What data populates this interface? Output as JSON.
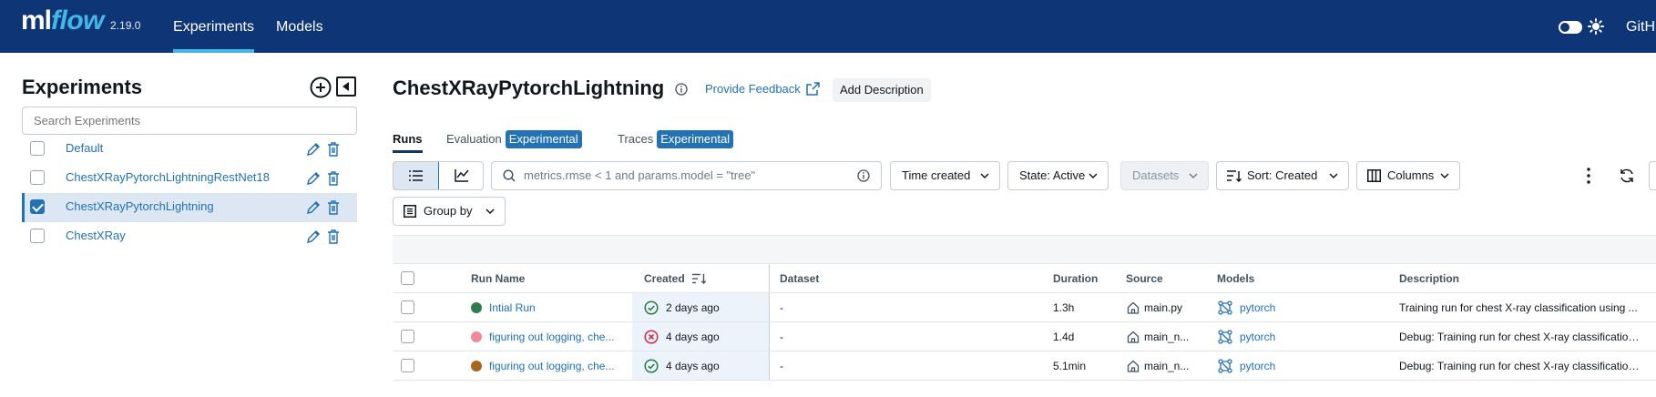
{
  "header": {
    "logo_ml": "ml",
    "logo_flow": "flow",
    "version": "2.19.0",
    "nav": [
      "Experiments",
      "Models"
    ],
    "github": "GitH",
    "brand_color": "#0e3576",
    "accent_color": "#43b7e8"
  },
  "sidebar": {
    "title": "Experiments",
    "search_placeholder": "Search Experiments",
    "items": [
      {
        "label": "Default",
        "checked": false
      },
      {
        "label": "ChestXRayPytorchLightningRestNet18",
        "checked": false
      },
      {
        "label": "ChestXRayPytorchLightning",
        "checked": true
      },
      {
        "label": "ChestXRay",
        "checked": false
      }
    ]
  },
  "main": {
    "title": "ChestXRayPytorchLightning",
    "feedback": "Provide Feedback",
    "add_description": "Add Description",
    "tabs": {
      "runs": "Runs",
      "evaluation": "Evaluation",
      "traces": "Traces",
      "badge": "Experimental"
    },
    "toolbar": {
      "filter_placeholder": "metrics.rmse < 1 and params.model = \"tree\"",
      "time_created": "Time created",
      "state": "State: Active",
      "datasets": "Datasets",
      "sort": "Sort: Created",
      "columns": "Columns",
      "group_by": "Group by"
    }
  },
  "table": {
    "columns": {
      "run_name": "Run Name",
      "created": "Created",
      "dataset": "Dataset",
      "duration": "Duration",
      "source": "Source",
      "models": "Models",
      "description": "Description"
    },
    "rows": [
      {
        "color": "#2e7d4a",
        "run_name": "Intial Run",
        "status": "success",
        "created": "2 days ago",
        "dataset": "-",
        "duration": "1.3h",
        "source": "main.py",
        "model": "pytorch",
        "description": "Training run for chest X-ray classification using ..."
      },
      {
        "color": "#f08a9a",
        "run_name": "figuring out logging, che...",
        "status": "failed",
        "created": "4 days ago",
        "dataset": "-",
        "duration": "1.4d",
        "source": "main_n...",
        "model": "pytorch",
        "description": "Debug: Training run for chest X-ray classification..."
      },
      {
        "color": "#a8661a",
        "run_name": "figuring out logging, che...",
        "status": "success",
        "created": "4 days ago",
        "dataset": "-",
        "duration": "5.1min",
        "source": "main_n...",
        "model": "pytorch",
        "description": "Debug: Training run for chest X-ray classification..."
      }
    ]
  }
}
